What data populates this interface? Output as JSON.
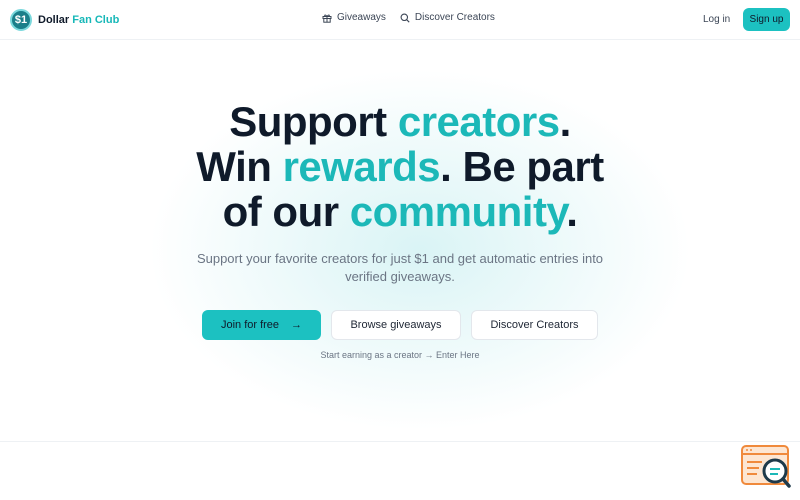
{
  "header": {
    "brand": {
      "logo_text": "$1",
      "name_part1": "Dollar",
      "name_part2": "Fan Club"
    },
    "nav": [
      {
        "label": "Giveaways",
        "icon": "gift-icon"
      },
      {
        "label": "Discover Creators",
        "icon": "search-icon"
      }
    ],
    "login_label": "Log in",
    "signup_label": "Sign up"
  },
  "hero": {
    "line1_a": "Support ",
    "line1_b": "creators",
    "line1_c": ".",
    "line2_a": "Win ",
    "line2_b": "rewards",
    "line2_c": ". Be part",
    "line3_a": "of our ",
    "line3_b": "community",
    "line3_c": ".",
    "subtitle": "Support your favorite creators for just $1 and get automatic entries into verified giveaways.",
    "primary_button": "Join for free",
    "primary_button_icon": "→",
    "secondary_button": "Browse giveaways",
    "tertiary_button": "Discover Creators",
    "creator_link": "Start earning as a creator → Enter Here"
  },
  "colors": {
    "accent": "#1cc1c1",
    "accent_text": "#1cb8b8",
    "dark": "#0f1a2a",
    "muted": "#6b7584"
  }
}
